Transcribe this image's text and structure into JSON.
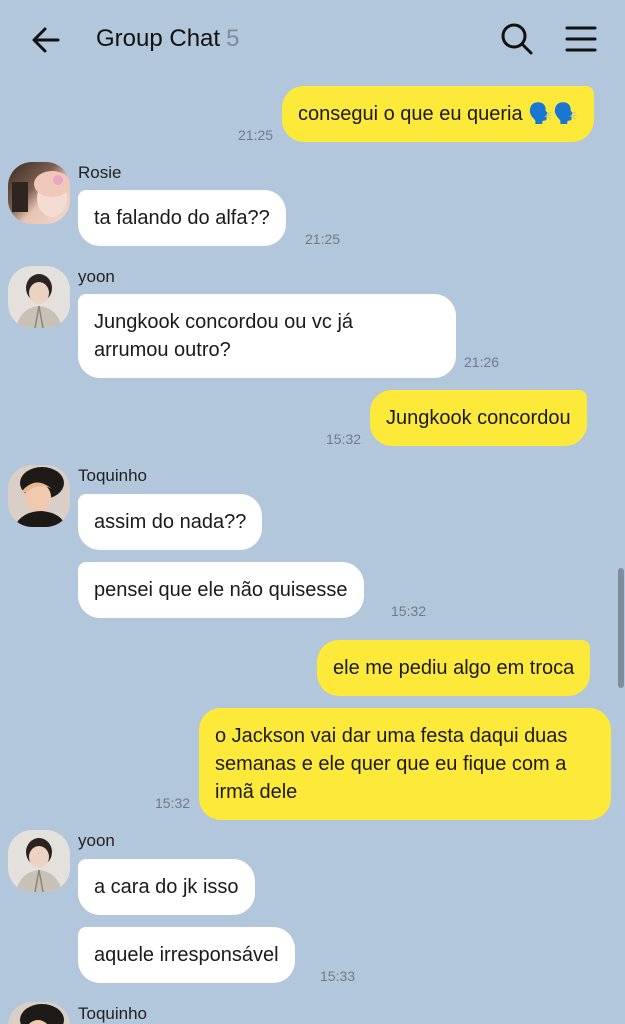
{
  "header": {
    "title": "Group Chat",
    "member_count": "5",
    "back_icon": "arrow-left-icon",
    "search_icon": "search-icon",
    "menu_icon": "hamburger-menu-icon"
  },
  "colors": {
    "background": "#b3c7dc",
    "outgoing_bubble": "#fde93a",
    "incoming_bubble": "#ffffff",
    "timestamp": "#6d7b88"
  },
  "messages": [
    {
      "direction": "out",
      "text": "consegui o que eu queria 🗣️🗣️",
      "time": "21:25"
    },
    {
      "direction": "in",
      "sender": "Rosie",
      "text": "ta falando do alfa??",
      "time": "21:25"
    },
    {
      "direction": "in",
      "sender": "yoon",
      "text_lines": [
        "Jungkook concordou ou vc já",
        "arrumou outro?"
      ],
      "time": "21:26"
    },
    {
      "direction": "out",
      "text": "Jungkook concordou",
      "time": "15:32"
    },
    {
      "direction": "in",
      "sender": "Toquinho",
      "text": "assim do nada??"
    },
    {
      "direction": "in",
      "text": "pensei que ele não quisesse",
      "time": "15:32"
    },
    {
      "direction": "out",
      "text": "ele me pediu algo em troca"
    },
    {
      "direction": "out",
      "text_lines": [
        "o Jackson vai dar uma festa daqui duas",
        "semanas e ele quer que eu fique com a",
        "irmã dele"
      ],
      "time": "15:32"
    },
    {
      "direction": "in",
      "sender": "yoon",
      "text": "a cara do jk isso"
    },
    {
      "direction": "in",
      "text": "aquele irresponsável",
      "time": "15:33"
    },
    {
      "direction": "in",
      "sender": "Toquinho"
    }
  ]
}
